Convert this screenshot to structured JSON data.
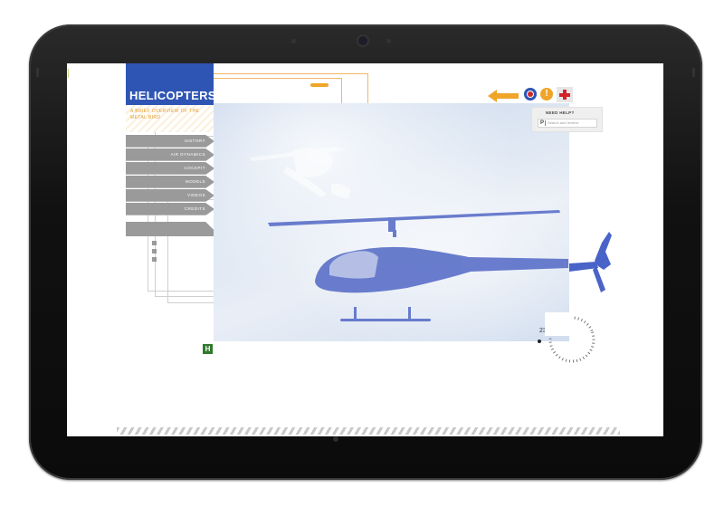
{
  "app": {
    "title": "HELICOPTERS",
    "subtitle": "A BRIEF OVERVIEW OF THE METAL BIRD"
  },
  "nav": {
    "items": [
      {
        "label": "HISTORY"
      },
      {
        "label": "AIR DYNAMICS"
      },
      {
        "label": "COCKPIT"
      },
      {
        "label": "MODELS"
      },
      {
        "label": "VIDEOS"
      },
      {
        "label": "CREDITS"
      }
    ]
  },
  "toolbar": {
    "warning_label": "!"
  },
  "help": {
    "label": "NEED HELP?",
    "search_placeholder": "Search and receive"
  },
  "hero": {
    "altitude": "2300m"
  },
  "badge": {
    "label": "H"
  },
  "colors": {
    "brand_blue": "#2f55b4",
    "accent_orange": "#f0a52a",
    "nav_gray": "#9a9a9a",
    "help_red": "#d2232a",
    "badge_green": "#2f7a2c",
    "helicopter_blue": "#5a6fc8"
  },
  "icons": {
    "back": "arrow-left-icon",
    "target": "target-icon",
    "warning": "warning-icon",
    "help": "plus-cross-icon"
  }
}
